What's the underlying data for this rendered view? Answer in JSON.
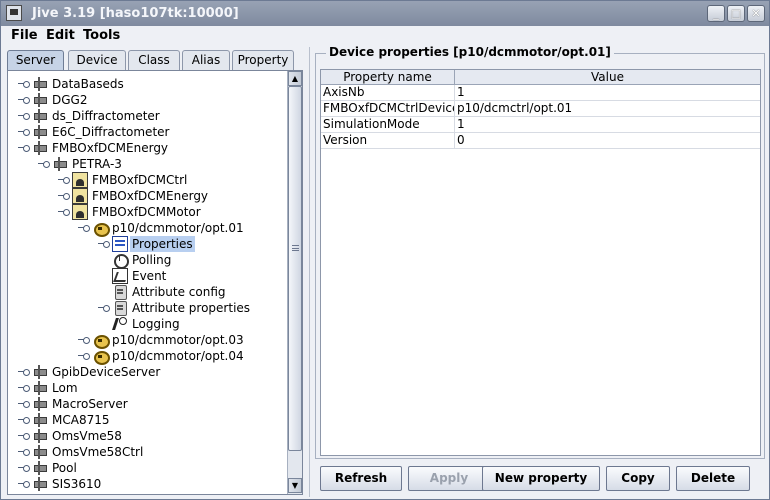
{
  "window": {
    "title": "Jive 3.19  [haso107tk:10000]",
    "controls": [
      "_",
      "□",
      "✕"
    ]
  },
  "menubar": [
    "File",
    "Edit",
    "Tools"
  ],
  "tabs": [
    {
      "label": "Server",
      "active": true
    },
    {
      "label": "Device",
      "active": false
    },
    {
      "label": "Class",
      "active": false
    },
    {
      "label": "Alias",
      "active": false
    },
    {
      "label": "Property",
      "active": false
    }
  ],
  "tree": [
    {
      "label": "DataBaseds",
      "icon": "server-icon",
      "depth": 0
    },
    {
      "label": "DGG2",
      "icon": "server-icon",
      "depth": 0
    },
    {
      "label": "ds_Diffractometer",
      "icon": "server-icon",
      "depth": 0
    },
    {
      "label": "E6C_Diffractometer",
      "icon": "server-icon",
      "depth": 0
    },
    {
      "label": "FMBOxfDCMEnergy",
      "icon": "server-icon",
      "depth": 0,
      "expanded": true
    },
    {
      "label": "PETRA-3",
      "icon": "server-icon",
      "depth": 1,
      "expanded": true
    },
    {
      "label": "FMBOxfDCMCtrl",
      "icon": "class-icon",
      "depth": 2
    },
    {
      "label": "FMBOxfDCMEnergy",
      "icon": "class-icon",
      "depth": 2
    },
    {
      "label": "FMBOxfDCMMotor",
      "icon": "class-icon",
      "depth": 2,
      "expanded": true
    },
    {
      "label": "p10/dcmmotor/opt.01",
      "icon": "device-icon",
      "depth": 3,
      "expanded": true
    },
    {
      "label": "Properties",
      "icon": "properties-icon",
      "depth": 4,
      "selected": true,
      "handle": true
    },
    {
      "label": "Polling",
      "icon": "polling-icon",
      "depth": 4
    },
    {
      "label": "Event",
      "icon": "event-icon",
      "depth": 4
    },
    {
      "label": "Attribute config",
      "icon": "attribute-config-icon",
      "depth": 4
    },
    {
      "label": "Attribute properties",
      "icon": "attribute-properties-icon",
      "depth": 4,
      "handle": true
    },
    {
      "label": "Logging",
      "icon": "logging-icon",
      "depth": 4
    },
    {
      "label": "p10/dcmmotor/opt.03",
      "icon": "device-icon",
      "depth": 3
    },
    {
      "label": "p10/dcmmotor/opt.04",
      "icon": "device-icon",
      "depth": 3
    },
    {
      "label": "GpibDeviceServer",
      "icon": "server-icon",
      "depth": 0
    },
    {
      "label": "Lom",
      "icon": "server-icon",
      "depth": 0
    },
    {
      "label": "MacroServer",
      "icon": "server-icon",
      "depth": 0
    },
    {
      "label": "MCA8715",
      "icon": "server-icon",
      "depth": 0
    },
    {
      "label": "OmsVme58",
      "icon": "server-icon",
      "depth": 0
    },
    {
      "label": "OmsVme58Ctrl",
      "icon": "server-icon",
      "depth": 0
    },
    {
      "label": "Pool",
      "icon": "server-icon",
      "depth": 0
    },
    {
      "label": "SIS3610",
      "icon": "server-icon",
      "depth": 0
    }
  ],
  "properties_panel": {
    "legend": "Device properties [p10/dcmmotor/opt.01]",
    "columns": [
      "Property name",
      "Value"
    ],
    "rows": [
      {
        "name": "AxisNb",
        "value": "1"
      },
      {
        "name": "FMBOxfDCMCtrlDevice",
        "value": "p10/dcmctrl/opt.01"
      },
      {
        "name": "SimulationMode",
        "value": "1"
      },
      {
        "name": "Version",
        "value": "0"
      }
    ]
  },
  "buttons": [
    {
      "label": "Refresh",
      "enabled": true
    },
    {
      "label": "Apply",
      "enabled": false
    },
    {
      "label": "New property",
      "enabled": true
    },
    {
      "label": "Copy",
      "enabled": true
    },
    {
      "label": "Delete",
      "enabled": true
    }
  ],
  "scrollbar": {
    "up_arrow": "▲",
    "down_arrow": "▼"
  }
}
